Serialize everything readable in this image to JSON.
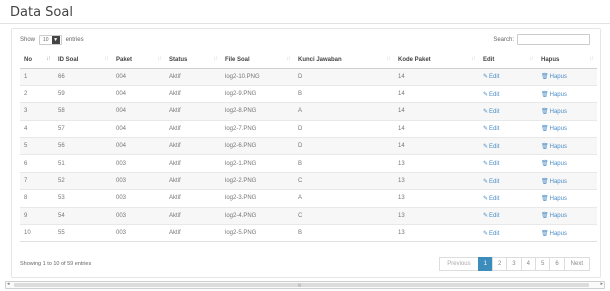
{
  "page": {
    "title": "Data Soal"
  },
  "controls": {
    "show_label": "Show",
    "entries_value": "10",
    "entries_label": "entries",
    "search_label": "Search:",
    "search_value": ""
  },
  "table": {
    "columns": [
      "No",
      "ID Soal",
      "Paket",
      "Status",
      "File Soal",
      "Kunci Jawaban",
      "Kode Paket",
      "Edit",
      "Hapus"
    ],
    "rows": [
      [
        "1",
        "66",
        "004",
        "Aktif",
        "log2-10.PNG",
        "D",
        "14",
        "Edit",
        "Hapus"
      ],
      [
        "2",
        "59",
        "004",
        "Aktif",
        "log2-9.PNG",
        "B",
        "14",
        "Edit",
        "Hapus"
      ],
      [
        "3",
        "58",
        "004",
        "Aktif",
        "log2-8.PNG",
        "A",
        "14",
        "Edit",
        "Hapus"
      ],
      [
        "4",
        "57",
        "004",
        "Aktif",
        "log2-7.PNG",
        "D",
        "14",
        "Edit",
        "Hapus"
      ],
      [
        "5",
        "56",
        "004",
        "Aktif",
        "log2-6.PNG",
        "D",
        "14",
        "Edit",
        "Hapus"
      ],
      [
        "6",
        "51",
        "003",
        "Aktif",
        "log2-1.PNG",
        "B",
        "13",
        "Edit",
        "Hapus"
      ],
      [
        "7",
        "52",
        "003",
        "Aktif",
        "log2-2.PNG",
        "C",
        "13",
        "Edit",
        "Hapus"
      ],
      [
        "8",
        "53",
        "003",
        "Aktif",
        "log2-3.PNG",
        "A",
        "13",
        "Edit",
        "Hapus"
      ],
      [
        "9",
        "54",
        "003",
        "Aktif",
        "log2-4.PNG",
        "C",
        "13",
        "Edit",
        "Hapus"
      ],
      [
        "10",
        "55",
        "003",
        "Aktif",
        "log2-5.PNG",
        "B",
        "13",
        "Edit",
        "Hapus"
      ]
    ]
  },
  "footer": {
    "info": "Showing 1 to 10 of 59 entries",
    "pagination": {
      "previous": "Previous",
      "pages": [
        "1",
        "2",
        "3",
        "4",
        "5",
        "6"
      ],
      "current": "1",
      "next": "Next"
    }
  },
  "icons": {
    "edit": "edit-icon",
    "delete": "trash-icon"
  },
  "colors": {
    "accent": "#3c8dbc",
    "link": "#4a8dc7"
  }
}
